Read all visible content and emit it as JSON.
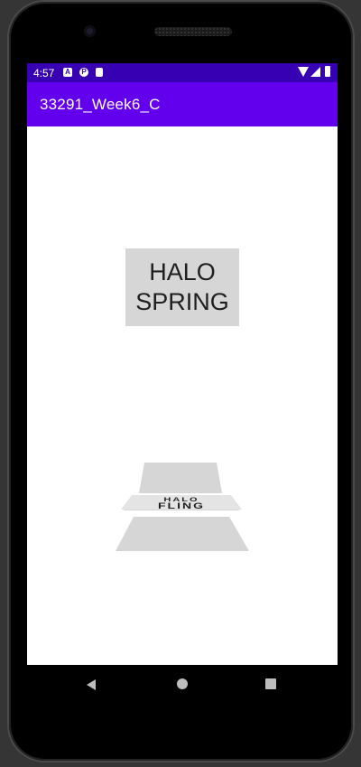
{
  "status_bar": {
    "time": "4:57",
    "notification_icons": [
      "a-icon",
      "p-icon",
      "sd-card-icon"
    ]
  },
  "app_bar": {
    "title": "33291_Week6_C",
    "color": "#6200ee",
    "status_color": "#3700b3"
  },
  "main": {
    "spring_button": {
      "line1": "HALO",
      "line2": "SPRING"
    },
    "fling_button": {
      "line1": "HALO",
      "line2": "FLING"
    }
  },
  "nav_bar": {
    "icons": [
      "back-icon",
      "home-icon",
      "recents-icon"
    ]
  }
}
